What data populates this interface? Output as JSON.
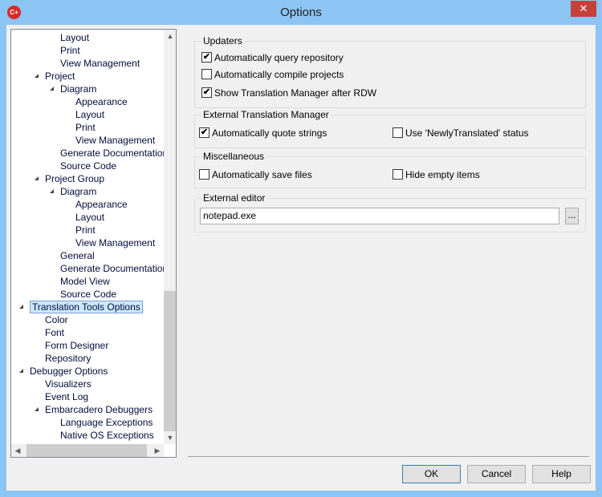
{
  "window": {
    "title": "Options",
    "close": "✕",
    "app_icon": "C+"
  },
  "tree": {
    "items": [
      {
        "label": "Layout",
        "level": 3,
        "exp": false
      },
      {
        "label": "Print",
        "level": 3,
        "exp": false
      },
      {
        "label": "View Management",
        "level": 3,
        "exp": false
      },
      {
        "label": "Project",
        "level": 2,
        "exp": true
      },
      {
        "label": "Diagram",
        "level": 3,
        "exp": true
      },
      {
        "label": "Appearance",
        "level": 4,
        "exp": false
      },
      {
        "label": "Layout",
        "level": 4,
        "exp": false
      },
      {
        "label": "Print",
        "level": 4,
        "exp": false
      },
      {
        "label": "View Management",
        "level": 4,
        "exp": false
      },
      {
        "label": "Generate Documentation",
        "level": 3,
        "exp": false
      },
      {
        "label": "Source Code",
        "level": 3,
        "exp": false
      },
      {
        "label": "Project Group",
        "level": 2,
        "exp": true
      },
      {
        "label": "Diagram",
        "level": 3,
        "exp": true
      },
      {
        "label": "Appearance",
        "level": 4,
        "exp": false
      },
      {
        "label": "Layout",
        "level": 4,
        "exp": false
      },
      {
        "label": "Print",
        "level": 4,
        "exp": false
      },
      {
        "label": "View Management",
        "level": 4,
        "exp": false
      },
      {
        "label": "General",
        "level": 3,
        "exp": false
      },
      {
        "label": "Generate Documentation",
        "level": 3,
        "exp": false
      },
      {
        "label": "Model View",
        "level": 3,
        "exp": false
      },
      {
        "label": "Source Code",
        "level": 3,
        "exp": false
      },
      {
        "label": "Translation Tools Options",
        "level": 1,
        "exp": true,
        "selected": true
      },
      {
        "label": "Color",
        "level": 2,
        "exp": false
      },
      {
        "label": "Font",
        "level": 2,
        "exp": false
      },
      {
        "label": "Form Designer",
        "level": 2,
        "exp": false
      },
      {
        "label": "Repository",
        "level": 2,
        "exp": false
      },
      {
        "label": "Debugger Options",
        "level": 1,
        "exp": true
      },
      {
        "label": "Visualizers",
        "level": 2,
        "exp": false
      },
      {
        "label": "Event Log",
        "level": 2,
        "exp": false
      },
      {
        "label": "Embarcadero Debuggers",
        "level": 2,
        "exp": true
      },
      {
        "label": "Language Exceptions",
        "level": 3,
        "exp": false
      },
      {
        "label": "Native OS Exceptions",
        "level": 3,
        "exp": false
      }
    ]
  },
  "updaters": {
    "title": "Updaters",
    "query": {
      "label": "Automatically query repository",
      "checked": true
    },
    "compile": {
      "label": "Automatically compile projects",
      "checked": false
    },
    "show": {
      "label": "Show Translation Manager after RDW",
      "checked": true
    }
  },
  "etm": {
    "title": "External Translation Manager",
    "quote": {
      "label": "Automatically quote strings",
      "checked": true
    },
    "newly": {
      "label": "Use 'NewlyTranslated' status",
      "checked": false
    }
  },
  "misc": {
    "title": "Miscellaneous",
    "save": {
      "label": "Automatically save files",
      "checked": false
    },
    "hide": {
      "label": "Hide empty items",
      "checked": false
    }
  },
  "editor": {
    "title": "External editor",
    "value": "notepad.exe",
    "browse": "..."
  },
  "buttons": {
    "ok": "OK",
    "cancel": "Cancel",
    "help": "Help"
  }
}
